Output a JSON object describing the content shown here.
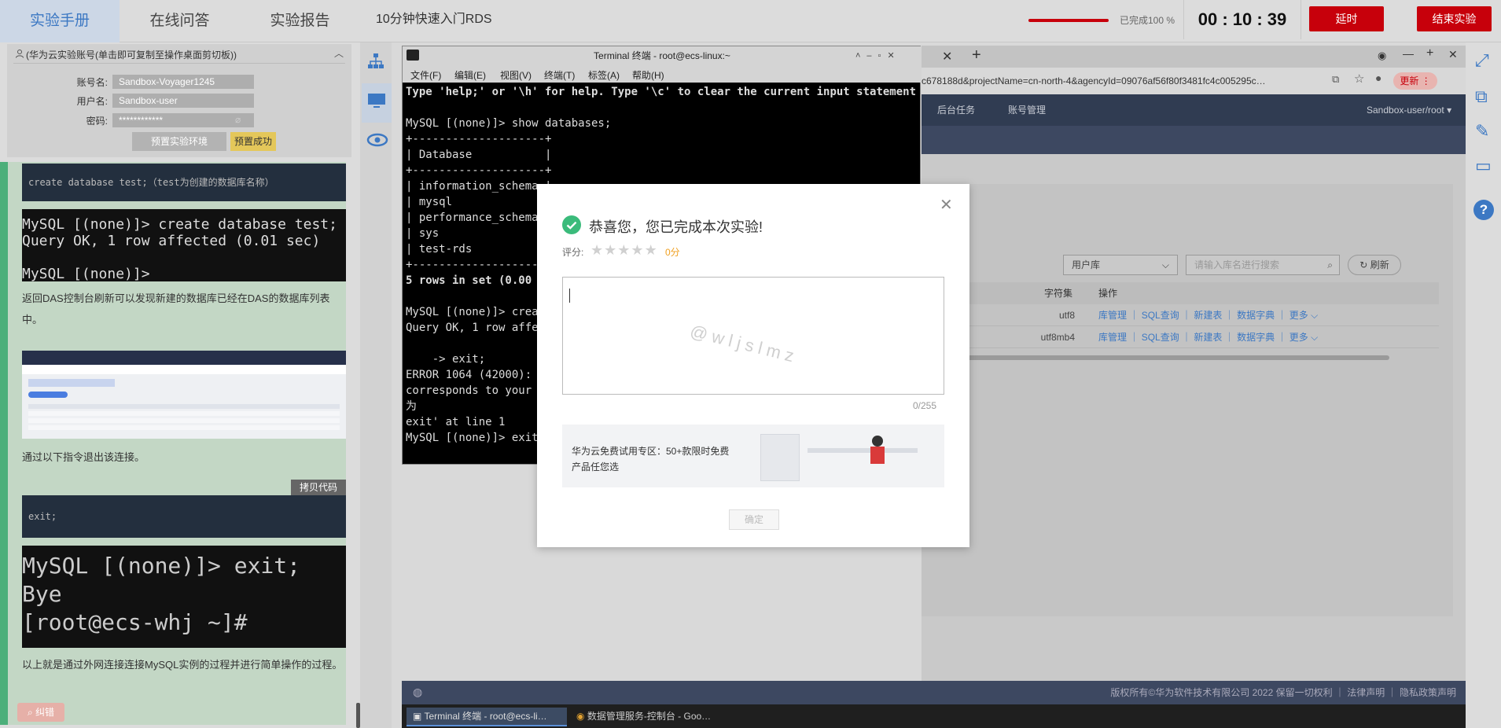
{
  "tabs": [
    {
      "label": "实验手册",
      "active": true
    },
    {
      "label": "在线问答",
      "active": false
    },
    {
      "label": "实验报告",
      "active": false
    }
  ],
  "course_title": "10分钟快速入门RDS",
  "progress": {
    "percent": 100,
    "text": "已完成100 %"
  },
  "timer": "00 : 10 : 39",
  "buttons": {
    "extend": "延时",
    "end": "结束实验"
  },
  "account": {
    "header": "(华为云实验账号(单击即可复制至操作桌面剪切板))",
    "rows": [
      {
        "label": "账号名:",
        "value": "Sandbox-Voyager1245"
      },
      {
        "label": "用户名:",
        "value": "Sandbox-user"
      },
      {
        "label": "密码:",
        "value": "************"
      }
    ],
    "reset_btn": "预置实验环境",
    "reset_ok": "预置成功"
  },
  "manual": {
    "code1": "create database test;（test为创建的数据库名称）",
    "term1": [
      "MySQL [(none)]> create database test;",
      "Query OK, 1 row affected (0.01 sec)",
      "",
      "MySQL [(none)]>"
    ],
    "para1": "返回DAS控制台刷新可以发现新建的数据库已经在DAS的数据库列表中。",
    "para2": "通过以下指令退出该连接。",
    "copy_btn": "拷贝代码",
    "code2": "exit;",
    "term2": [
      "MySQL [(none)]> exit;",
      "Bye",
      "[root@ecs-whj ~]#"
    ],
    "para3": "以上就是通过外网连接连接MySQL实例的过程并进行简单操作的过程。",
    "float_btn": "纠错"
  },
  "terminal": {
    "title": "Terminal 终端 - root@ecs-linux:~",
    "menu": [
      "文件(F)",
      "编辑(E)",
      "视图(V)",
      "终端(T)",
      "标签(A)",
      "帮助(H)"
    ],
    "lines": [
      "Type 'help;' or '\\h' for help. Type '\\c' to clear the current input statement.",
      "",
      "MySQL [(none)]> show databases;",
      "+--------------------+",
      "| Database           |",
      "+--------------------+",
      "| information_schema |",
      "| mysql              |",
      "| performance_schema |",
      "| sys                |",
      "| test-rds           |",
      "+--------------------+",
      "5 rows in set (0.00 s",
      "",
      "MySQL [(none)]> creat",
      "Query OK, 1 row affec",
      "",
      "    -> exit;",
      "ERROR 1064 (42000): Y",
      "corresponds to your M",
      "为",
      "exit' at line 1",
      "MySQL [(none)]> exit;"
    ]
  },
  "browser": {
    "url": "c678188d&projectName=cn-north-4&agencyId=09076af56f80f3481fc4c005295c…",
    "update_btn": "更新",
    "nav": [
      "后台任务",
      "账号管理"
    ],
    "user": "Sandbox-user/root",
    "db_select": "用户库",
    "search_placeholder": "请输入库名进行搜索",
    "refresh": "刷新",
    "columns": [
      "字符集",
      "操作"
    ],
    "rows": [
      {
        "charset": "utf8"
      },
      {
        "charset": "utf8mb4"
      }
    ],
    "actions": [
      "库管理",
      "SQL查询",
      "新建表",
      "数据字典",
      "更多"
    ],
    "footer": [
      "版权所有©华为软件技术有限公司 2022 保留一切权利",
      "法律声明",
      "隐私政策声明"
    ]
  },
  "taskbar": [
    {
      "label": "Terminal 终端 - root@ecs-li…",
      "active": true
    },
    {
      "label": "数据管理服务-控制台 - Goo…",
      "active": false
    }
  ],
  "modal": {
    "title": "恭喜您，您已完成本次实验!",
    "rating_label": "评分:",
    "rating_stars": 0,
    "rating_value": "0分",
    "watermark": "@wljslmz",
    "counter": "0/255",
    "promo": "华为云免费试用专区：50+款限时免费产品任您选",
    "confirm": "确定"
  }
}
